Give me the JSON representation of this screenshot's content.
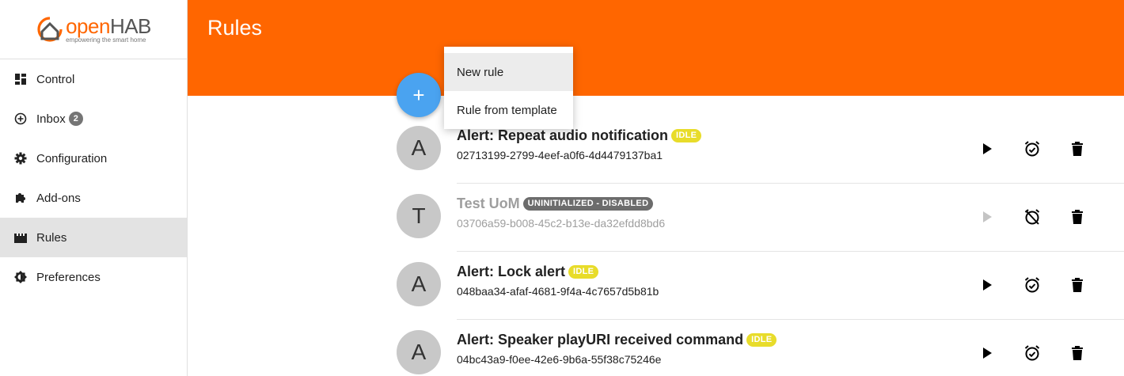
{
  "app": {
    "logo_open": "open",
    "logo_hab": "HAB",
    "logo_tagline": "empowering the smart home"
  },
  "sidebar": {
    "items": [
      {
        "label": "Control",
        "icon": "dashboard-icon"
      },
      {
        "label": "Inbox",
        "icon": "plus-circle-icon",
        "badge": "2"
      },
      {
        "label": "Configuration",
        "icon": "gear-icon"
      },
      {
        "label": "Add-ons",
        "icon": "puzzle-icon"
      },
      {
        "label": "Rules",
        "icon": "clapperboard-icon",
        "active": true
      },
      {
        "label": "Preferences",
        "icon": "brightness-icon"
      }
    ]
  },
  "header": {
    "title": "Rules"
  },
  "fab": {
    "label": "+"
  },
  "menu": {
    "items": [
      {
        "label": "New rule"
      },
      {
        "label": "Rule from template"
      }
    ]
  },
  "rules": [
    {
      "avatar": "A",
      "name": "Alert: Repeat audio notification",
      "status": "IDLE",
      "uid": "02713199-2799-4eef-a0f6-4d4479137ba1"
    },
    {
      "avatar": "T",
      "name": "Test UoM",
      "status": "UNINITIALIZED - DISABLED",
      "uid": "03706a59-b008-45c2-b13e-da32efdd8bd6"
    },
    {
      "avatar": "A",
      "name": "Alert: Lock alert",
      "status": "IDLE",
      "uid": "048baa34-afaf-4681-9f4a-4c7657d5b81b"
    },
    {
      "avatar": "A",
      "name": "Alert: Speaker playURI received command",
      "status": "IDLE",
      "uid": "04bc43a9-f0ee-42e6-9b6a-55f38c75246e"
    }
  ],
  "colors": {
    "brand": "#ff6600",
    "fab": "#4aa3f0",
    "idle_badge": "#e8dc2a",
    "disabled_badge": "#6c6c6c"
  }
}
